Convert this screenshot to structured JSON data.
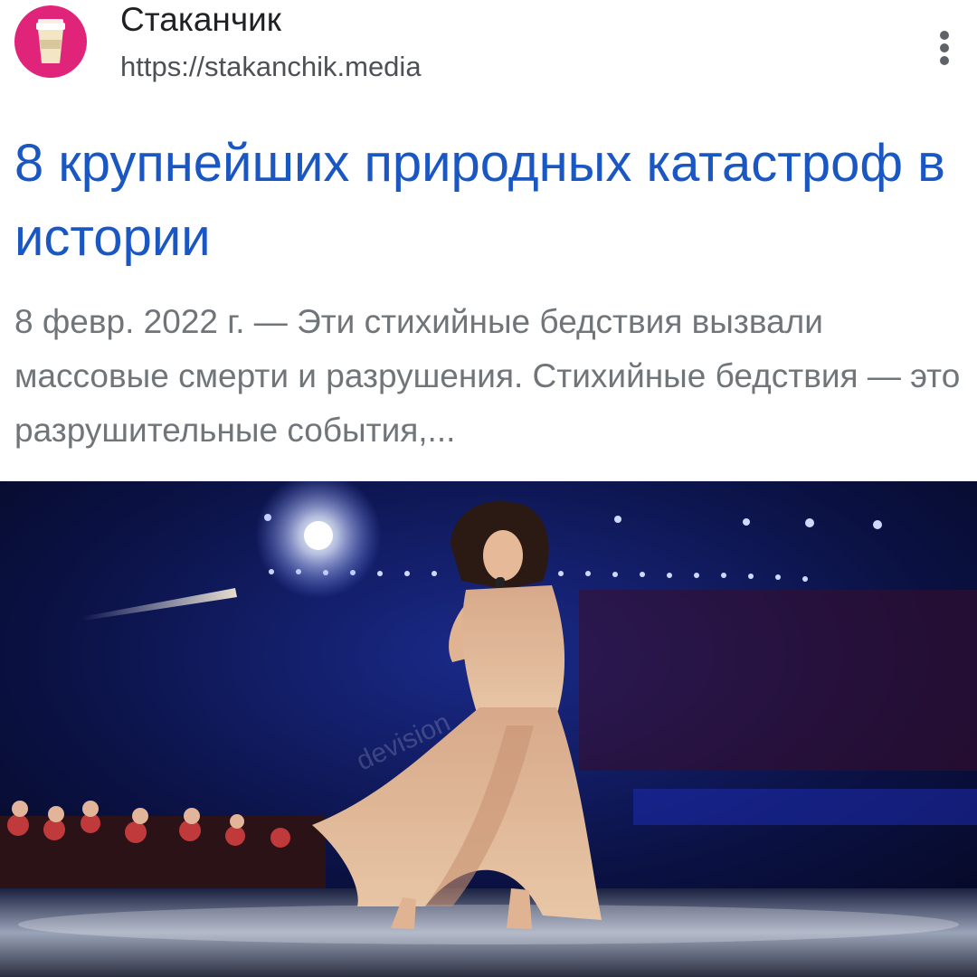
{
  "result": {
    "site_name": "Стаканчик",
    "site_url": "https://stakanchik.media",
    "title": "8 крупнейших природных катастроф в истории",
    "snippet_date": "8 февр. 2022 г.",
    "snippet_separator": " — ",
    "snippet_text": "Эти стихийные бедствия вызвали массовые смерти и разрушения. Стихийные бедствия — это разрушительные события,...",
    "logo_icon": "paper-cup-icon",
    "more_icon": "more-vert-icon"
  },
  "image": {
    "subject": "performer-on-stage-photo",
    "watermark": "devision"
  },
  "colors": {
    "title_link": "#1a57c2",
    "logo_background": "#e0247a",
    "snippet_text": "#70757a"
  }
}
